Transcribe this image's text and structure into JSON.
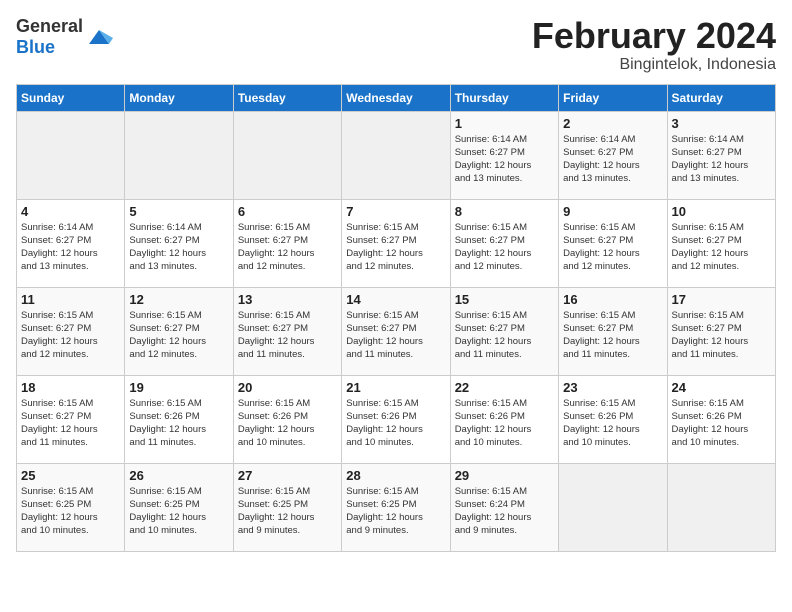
{
  "logo": {
    "text_general": "General",
    "text_blue": "Blue"
  },
  "header": {
    "month": "February 2024",
    "location": "Bingintelok, Indonesia"
  },
  "weekdays": [
    "Sunday",
    "Monday",
    "Tuesday",
    "Wednesday",
    "Thursday",
    "Friday",
    "Saturday"
  ],
  "weeks": [
    [
      {
        "day": "",
        "info": ""
      },
      {
        "day": "",
        "info": ""
      },
      {
        "day": "",
        "info": ""
      },
      {
        "day": "",
        "info": ""
      },
      {
        "day": "1",
        "info": "Sunrise: 6:14 AM\nSunset: 6:27 PM\nDaylight: 12 hours\nand 13 minutes."
      },
      {
        "day": "2",
        "info": "Sunrise: 6:14 AM\nSunset: 6:27 PM\nDaylight: 12 hours\nand 13 minutes."
      },
      {
        "day": "3",
        "info": "Sunrise: 6:14 AM\nSunset: 6:27 PM\nDaylight: 12 hours\nand 13 minutes."
      }
    ],
    [
      {
        "day": "4",
        "info": "Sunrise: 6:14 AM\nSunset: 6:27 PM\nDaylight: 12 hours\nand 13 minutes."
      },
      {
        "day": "5",
        "info": "Sunrise: 6:14 AM\nSunset: 6:27 PM\nDaylight: 12 hours\nand 13 minutes."
      },
      {
        "day": "6",
        "info": "Sunrise: 6:15 AM\nSunset: 6:27 PM\nDaylight: 12 hours\nand 12 minutes."
      },
      {
        "day": "7",
        "info": "Sunrise: 6:15 AM\nSunset: 6:27 PM\nDaylight: 12 hours\nand 12 minutes."
      },
      {
        "day": "8",
        "info": "Sunrise: 6:15 AM\nSunset: 6:27 PM\nDaylight: 12 hours\nand 12 minutes."
      },
      {
        "day": "9",
        "info": "Sunrise: 6:15 AM\nSunset: 6:27 PM\nDaylight: 12 hours\nand 12 minutes."
      },
      {
        "day": "10",
        "info": "Sunrise: 6:15 AM\nSunset: 6:27 PM\nDaylight: 12 hours\nand 12 minutes."
      }
    ],
    [
      {
        "day": "11",
        "info": "Sunrise: 6:15 AM\nSunset: 6:27 PM\nDaylight: 12 hours\nand 12 minutes."
      },
      {
        "day": "12",
        "info": "Sunrise: 6:15 AM\nSunset: 6:27 PM\nDaylight: 12 hours\nand 12 minutes."
      },
      {
        "day": "13",
        "info": "Sunrise: 6:15 AM\nSunset: 6:27 PM\nDaylight: 12 hours\nand 11 minutes."
      },
      {
        "day": "14",
        "info": "Sunrise: 6:15 AM\nSunset: 6:27 PM\nDaylight: 12 hours\nand 11 minutes."
      },
      {
        "day": "15",
        "info": "Sunrise: 6:15 AM\nSunset: 6:27 PM\nDaylight: 12 hours\nand 11 minutes."
      },
      {
        "day": "16",
        "info": "Sunrise: 6:15 AM\nSunset: 6:27 PM\nDaylight: 12 hours\nand 11 minutes."
      },
      {
        "day": "17",
        "info": "Sunrise: 6:15 AM\nSunset: 6:27 PM\nDaylight: 12 hours\nand 11 minutes."
      }
    ],
    [
      {
        "day": "18",
        "info": "Sunrise: 6:15 AM\nSunset: 6:27 PM\nDaylight: 12 hours\nand 11 minutes."
      },
      {
        "day": "19",
        "info": "Sunrise: 6:15 AM\nSunset: 6:26 PM\nDaylight: 12 hours\nand 11 minutes."
      },
      {
        "day": "20",
        "info": "Sunrise: 6:15 AM\nSunset: 6:26 PM\nDaylight: 12 hours\nand 10 minutes."
      },
      {
        "day": "21",
        "info": "Sunrise: 6:15 AM\nSunset: 6:26 PM\nDaylight: 12 hours\nand 10 minutes."
      },
      {
        "day": "22",
        "info": "Sunrise: 6:15 AM\nSunset: 6:26 PM\nDaylight: 12 hours\nand 10 minutes."
      },
      {
        "day": "23",
        "info": "Sunrise: 6:15 AM\nSunset: 6:26 PM\nDaylight: 12 hours\nand 10 minutes."
      },
      {
        "day": "24",
        "info": "Sunrise: 6:15 AM\nSunset: 6:26 PM\nDaylight: 12 hours\nand 10 minutes."
      }
    ],
    [
      {
        "day": "25",
        "info": "Sunrise: 6:15 AM\nSunset: 6:25 PM\nDaylight: 12 hours\nand 10 minutes."
      },
      {
        "day": "26",
        "info": "Sunrise: 6:15 AM\nSunset: 6:25 PM\nDaylight: 12 hours\nand 10 minutes."
      },
      {
        "day": "27",
        "info": "Sunrise: 6:15 AM\nSunset: 6:25 PM\nDaylight: 12 hours\nand 9 minutes."
      },
      {
        "day": "28",
        "info": "Sunrise: 6:15 AM\nSunset: 6:25 PM\nDaylight: 12 hours\nand 9 minutes."
      },
      {
        "day": "29",
        "info": "Sunrise: 6:15 AM\nSunset: 6:24 PM\nDaylight: 12 hours\nand 9 minutes."
      },
      {
        "day": "",
        "info": ""
      },
      {
        "day": "",
        "info": ""
      }
    ]
  ]
}
